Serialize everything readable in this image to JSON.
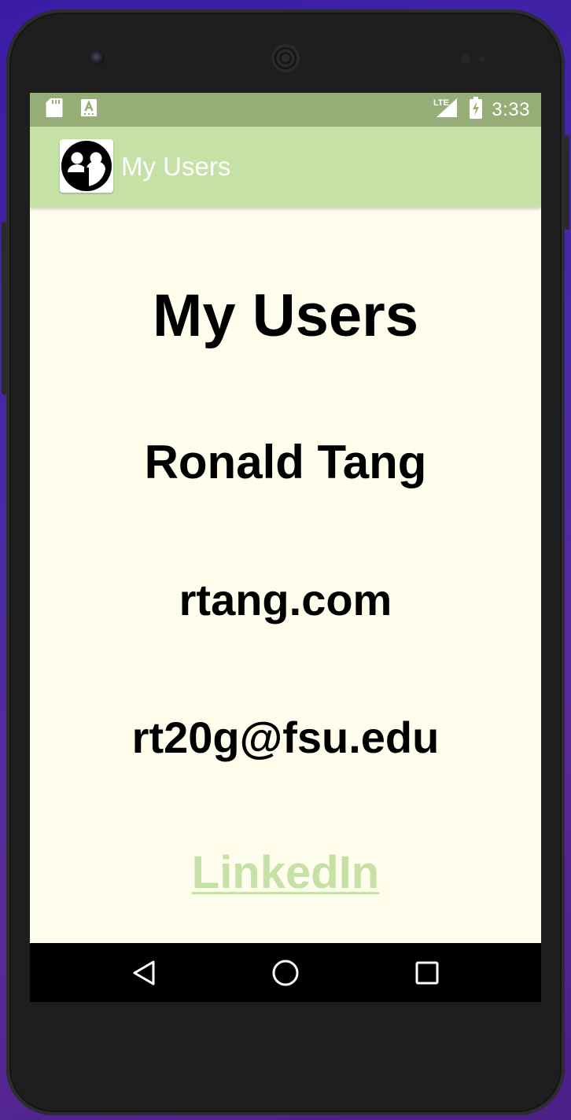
{
  "status_bar": {
    "time": "3:33",
    "network": "LTE",
    "icons": [
      "sd-card-icon",
      "keyboard-a-icon",
      "lte-signal-icon",
      "battery-charging-icon"
    ]
  },
  "app_bar": {
    "title": "My Users",
    "logo_icon": "users-logo-icon"
  },
  "profile": {
    "heading": "My Users",
    "name": "Ronald Tang",
    "website": "rtang.com",
    "email": "rt20g@fsu.edu",
    "link_label": "LinkedIn"
  },
  "nav_bar": {
    "icons": [
      "back-icon",
      "home-icon",
      "recents-icon"
    ]
  },
  "colors": {
    "status_bar": "#96ad78",
    "app_bar": "#c5e1a5",
    "background": "#fffdeb",
    "link": "#c5e1a5",
    "text": "#000000",
    "nav_bar": "#000000"
  }
}
